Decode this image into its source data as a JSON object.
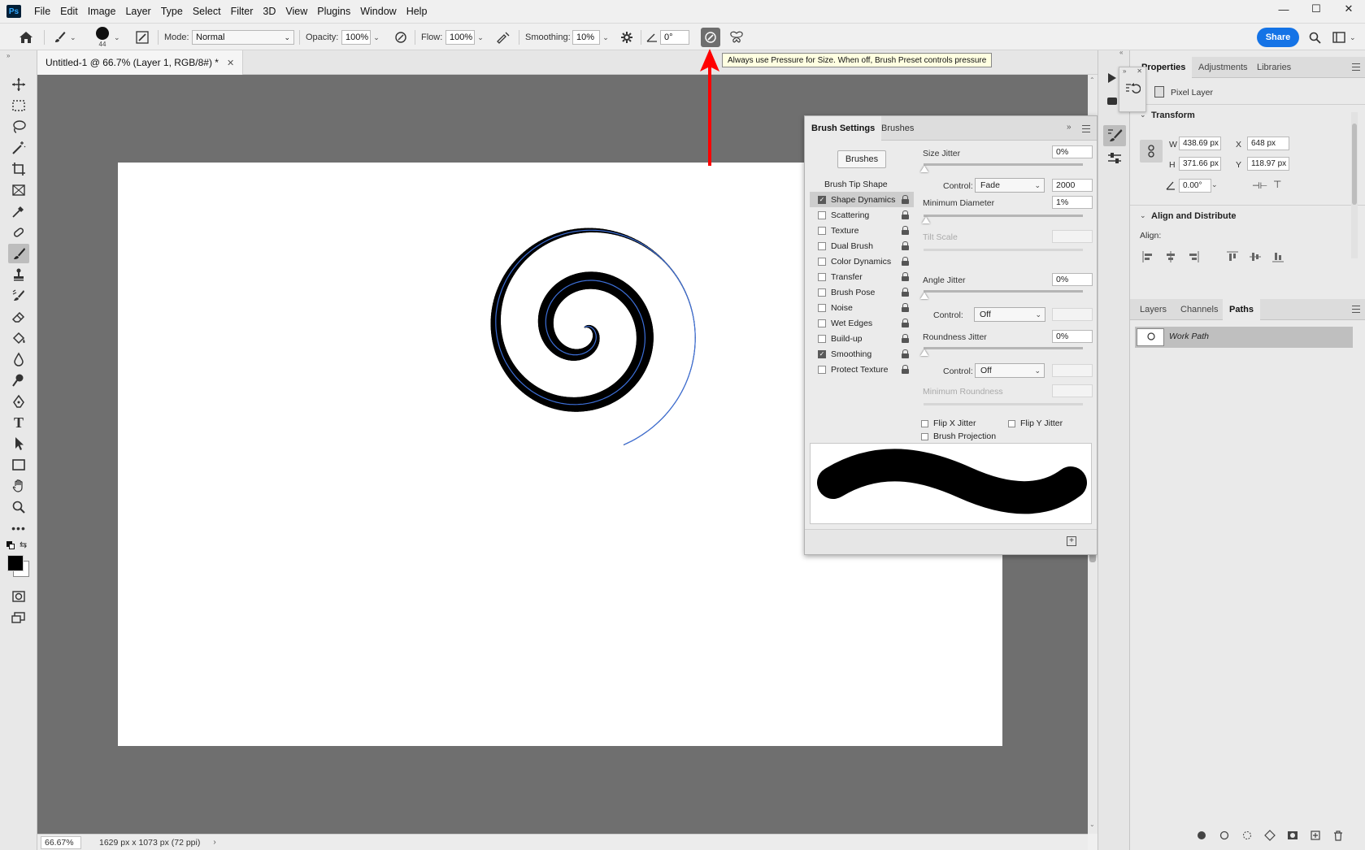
{
  "app": {
    "logo": "Ps"
  },
  "menu": [
    "File",
    "Edit",
    "Image",
    "Layer",
    "Type",
    "Select",
    "Filter",
    "3D",
    "View",
    "Plugins",
    "Window",
    "Help"
  ],
  "window_controls": {
    "minimize": "—",
    "maximize": "☐",
    "close": "✕"
  },
  "options": {
    "brush_size": "44",
    "mode_label": "Mode:",
    "mode_value": "Normal",
    "opacity_label": "Opacity:",
    "opacity_value": "100%",
    "flow_label": "Flow:",
    "flow_value": "100%",
    "smoothing_label": "Smoothing:",
    "smoothing_value": "10%",
    "angle_value": "0°",
    "share_label": "Share"
  },
  "tooltip": "Always use Pressure for Size. When off, Brush Preset controls pressure",
  "document": {
    "tab_title": "Untitled-1 @ 66.7% (Layer 1, RGB/8#) *",
    "zoom": "66.67%",
    "info": "1629 px x 1073 px (72 ppi)"
  },
  "brush_settings": {
    "tabs": [
      "Brush Settings",
      "Brushes"
    ],
    "brushes_button": "Brushes",
    "tip_shape": "Brush Tip Shape",
    "items": [
      {
        "label": "Shape Dynamics",
        "checked": true,
        "selected": true
      },
      {
        "label": "Scattering",
        "checked": false
      },
      {
        "label": "Texture",
        "checked": false
      },
      {
        "label": "Dual Brush",
        "checked": false
      },
      {
        "label": "Color Dynamics",
        "checked": false
      },
      {
        "label": "Transfer",
        "checked": false
      },
      {
        "label": "Brush Pose",
        "checked": false
      },
      {
        "label": "Noise",
        "checked": false
      },
      {
        "label": "Wet Edges",
        "checked": false
      },
      {
        "label": "Build-up",
        "checked": false
      },
      {
        "label": "Smoothing",
        "checked": true
      },
      {
        "label": "Protect Texture",
        "checked": false
      }
    ],
    "size_jitter_label": "Size Jitter",
    "size_jitter_value": "0%",
    "control_label": "Control:",
    "control1_value": "Fade",
    "fade_steps": "2000",
    "min_diameter_label": "Minimum Diameter",
    "min_diameter_value": "1%",
    "tilt_scale_label": "Tilt Scale",
    "angle_jitter_label": "Angle Jitter",
    "angle_jitter_value": "0%",
    "control2_value": "Off",
    "roundness_jitter_label": "Roundness Jitter",
    "roundness_jitter_value": "0%",
    "control3_value": "Off",
    "min_roundness_label": "Minimum Roundness",
    "flip_x": "Flip X Jitter",
    "flip_y": "Flip Y Jitter",
    "brush_projection": "Brush Projection"
  },
  "properties": {
    "tabs": [
      "Properties",
      "Adjustments",
      "Libraries"
    ],
    "layer_type": "Pixel Layer",
    "transform_title": "Transform",
    "w_label": "W",
    "w_value": "438.69 px",
    "h_label": "H",
    "h_value": "371.66 px",
    "x_label": "X",
    "x_value": "648 px",
    "y_label": "Y",
    "y_value": "118.97 px",
    "angle_value": "0.00°",
    "align_title": "Align and Distribute",
    "align_label": "Align:"
  },
  "layers_panel": {
    "tabs": [
      "Layers",
      "Channels",
      "Paths"
    ],
    "work_path": "Work Path"
  }
}
